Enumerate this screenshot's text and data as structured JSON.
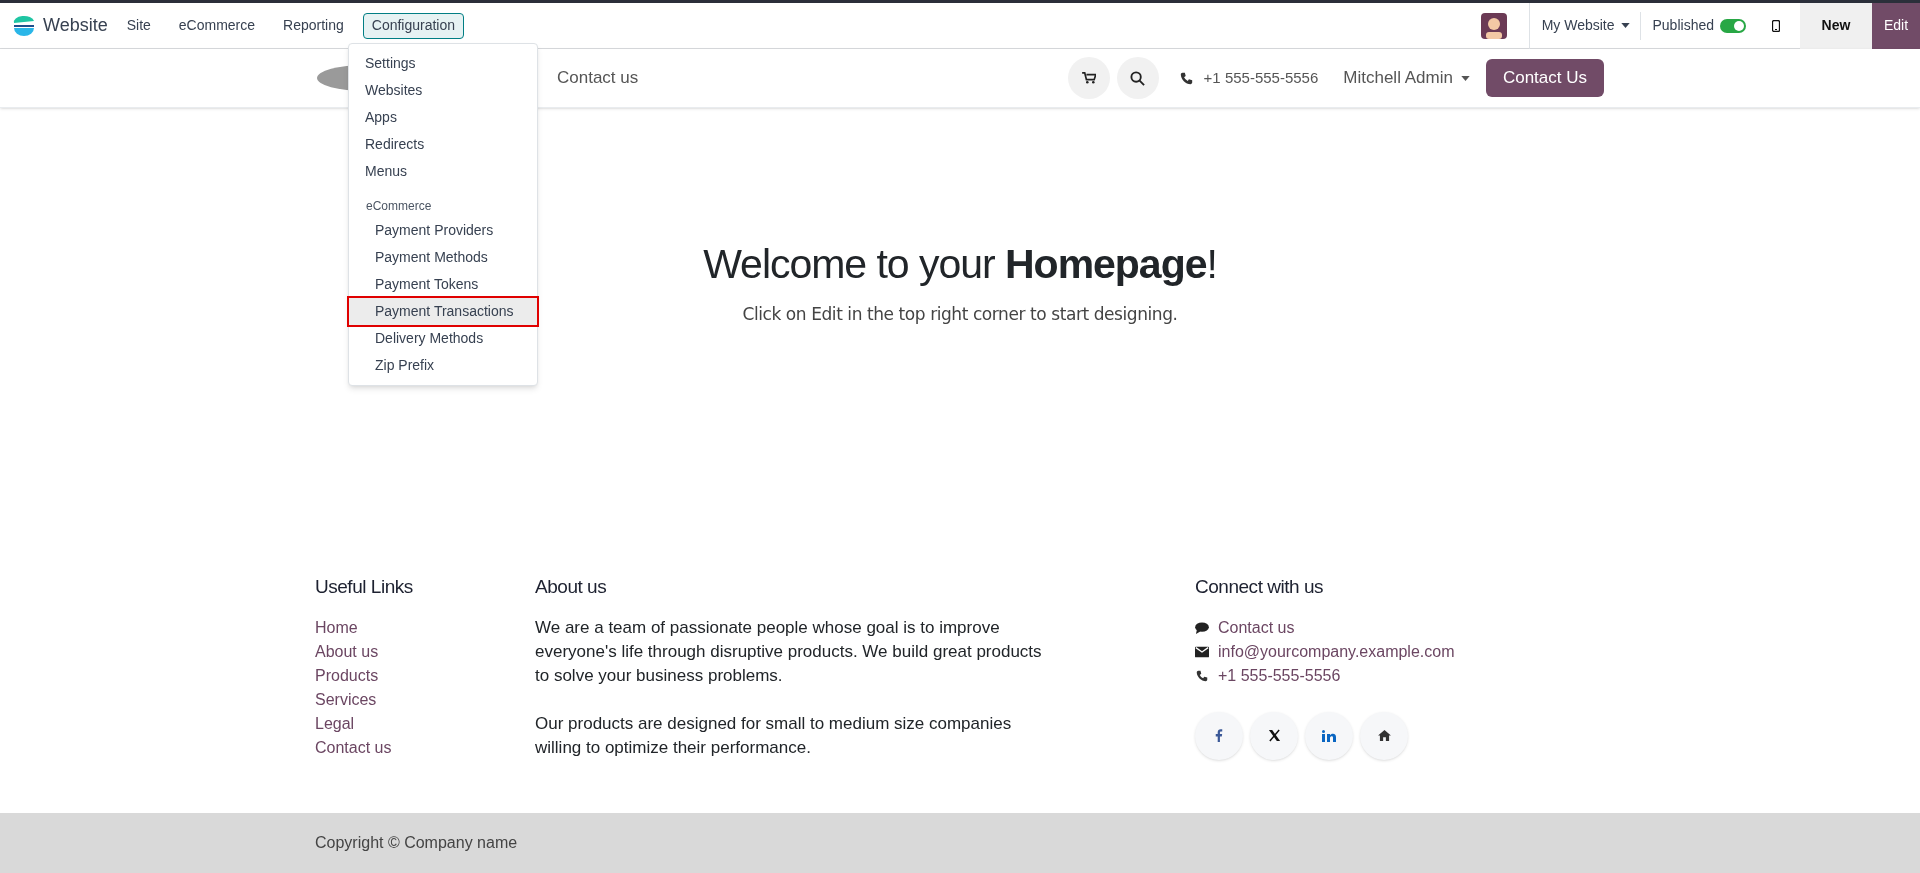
{
  "top_bar": {
    "app_name": "Website",
    "menu": [
      {
        "label": "Site",
        "selected": false
      },
      {
        "label": "eCommerce",
        "selected": false
      },
      {
        "label": "Reporting",
        "selected": false
      },
      {
        "label": "Configuration",
        "selected": true
      }
    ],
    "website_switcher": "My Website",
    "published": {
      "label": "Published",
      "on": true
    },
    "new_button": "New",
    "edit_button": "Edit"
  },
  "dropdown": [
    {
      "kind": "item",
      "label": "Settings",
      "selected": false
    },
    {
      "kind": "item",
      "label": "Websites",
      "selected": false
    },
    {
      "kind": "item",
      "label": "Apps",
      "selected": false
    },
    {
      "kind": "item",
      "label": "Redirects",
      "selected": false
    },
    {
      "kind": "item",
      "label": "Menus",
      "selected": false
    },
    {
      "kind": "header",
      "label": "eCommerce"
    },
    {
      "kind": "subitem",
      "label": "Payment Providers",
      "selected": false
    },
    {
      "kind": "subitem",
      "label": "Payment Methods",
      "selected": false
    },
    {
      "kind": "subitem",
      "label": "Payment Tokens",
      "selected": false
    },
    {
      "kind": "subitem",
      "label": "Payment Transactions",
      "selected": true
    },
    {
      "kind": "subitem",
      "label": "Delivery Methods",
      "selected": false
    },
    {
      "kind": "subitem",
      "label": "Zip Prefix",
      "selected": false
    }
  ],
  "site_header": {
    "nav_link": "Contact us",
    "phone": "+1 555-555-5556",
    "user": "Mitchell Admin",
    "cta": "Contact Us"
  },
  "hero": {
    "title": "Welcome to your **Homepage**!",
    "subtitle": "Click on Edit in the top right corner to start designing."
  },
  "footer": {
    "useful_links": {
      "title": "Useful Links",
      "links": [
        "Home",
        "About us",
        "Products",
        "Services",
        "Legal",
        "Contact us"
      ]
    },
    "about": {
      "title": "About us",
      "paragraphs": [
        "We are a team of passionate people whose goal is to improve everyone's life through disruptive products. We build great products to solve your business problems.",
        "Our products are designed for small to medium size companies willing to optimize their performance."
      ]
    },
    "connect": {
      "title": "Connect with us",
      "items": [
        {
          "kind": "chat",
          "label": "Contact us"
        },
        {
          "kind": "mail",
          "label": "info@yourcompany.example.com"
        },
        {
          "kind": "phone",
          "label": "+1 555-555-5556"
        }
      ]
    },
    "copyright": "Copyright © Company name"
  }
}
